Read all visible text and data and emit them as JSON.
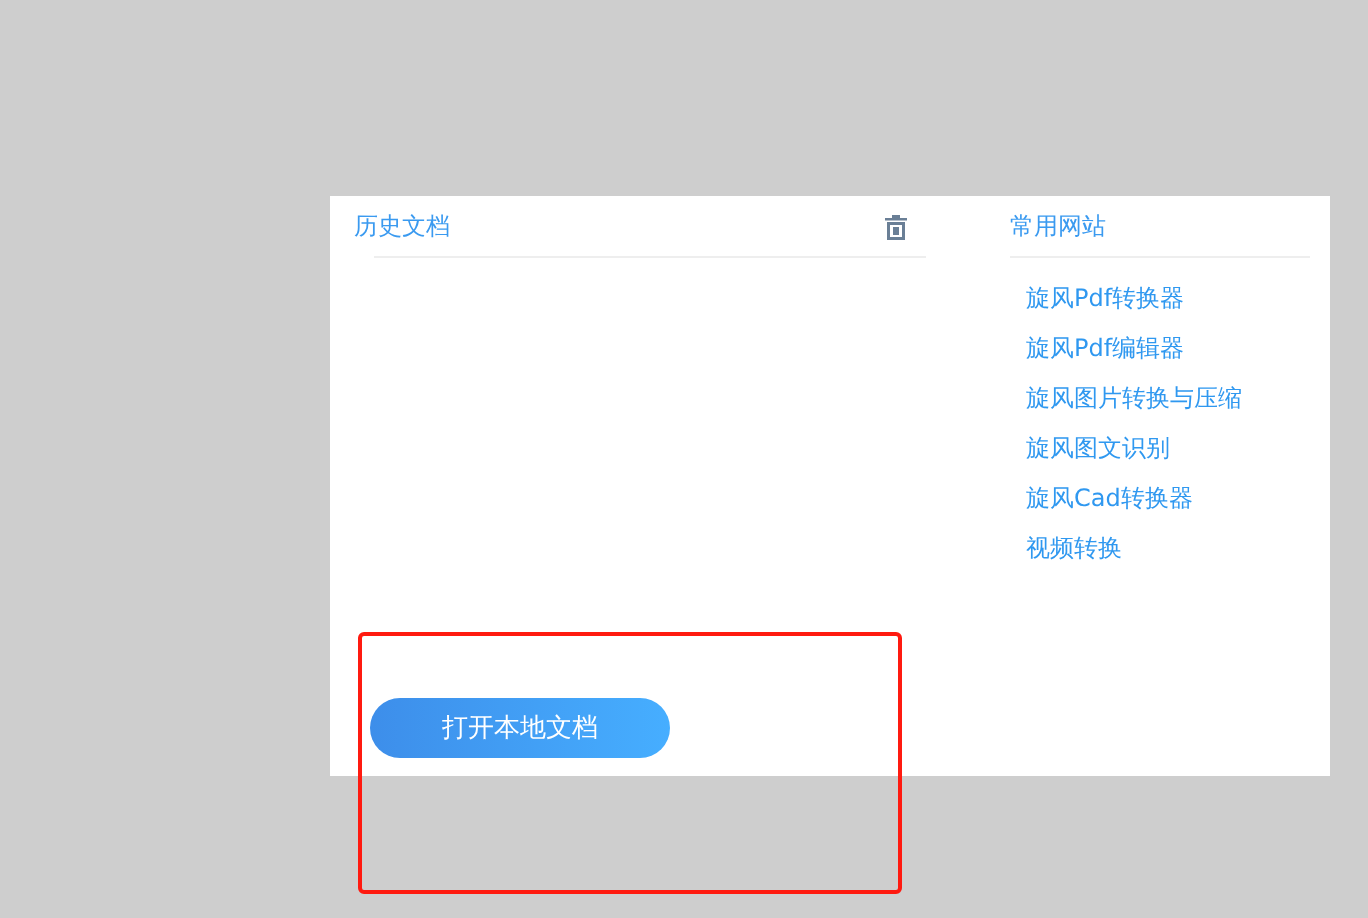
{
  "history": {
    "title": "历史文档",
    "open_button": "打开本地文档"
  },
  "sites": {
    "title": "常用网站",
    "links": [
      "旋风Pdf转换器",
      "旋风Pdf编辑器",
      "旋风图片转换与压缩",
      "旋风图文识别",
      "旋风Cad转换器",
      "视频转换"
    ]
  },
  "highlight_box": true
}
